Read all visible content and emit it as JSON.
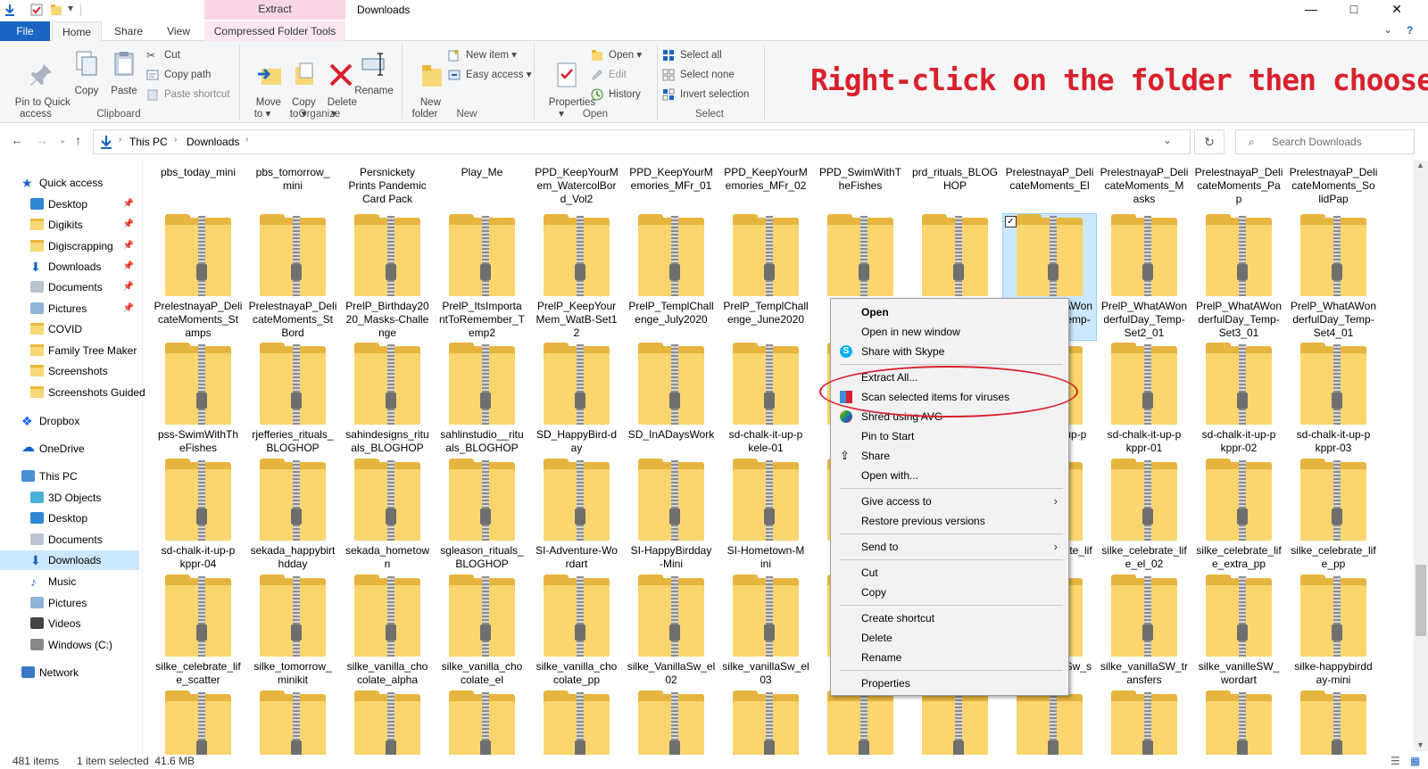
{
  "window": {
    "title": "Downloads",
    "contextual_tab_header": "Extract",
    "controls": {
      "minimize": "—",
      "maximize": "□",
      "close": "✕"
    }
  },
  "tabs": [
    {
      "label": "File"
    },
    {
      "label": "Home"
    },
    {
      "label": "Share"
    },
    {
      "label": "View"
    },
    {
      "label": "Compressed Folder Tools"
    }
  ],
  "ribbon": {
    "clipboard": {
      "group_label": "Clipboard",
      "pin_label": "Pin to Quick\naccess",
      "copy_label": "Copy",
      "paste_label": "Paste",
      "cut_label": "Cut",
      "copy_path_label": "Copy path",
      "paste_shortcut_label": "Paste shortcut"
    },
    "organize": {
      "group_label": "Organize",
      "move_to_label": "Move\nto ▾",
      "copy_to_label": "Copy\nto ▾",
      "delete_label": "Delete\n▾",
      "rename_label": "Rename"
    },
    "new": {
      "group_label": "New",
      "new_folder_label": "New\nfolder",
      "new_item_label": "New item ▾",
      "easy_access_label": "Easy access ▾"
    },
    "open": {
      "group_label": "Open",
      "properties_label": "Properties\n▾",
      "open_label": "Open ▾",
      "edit_label": "Edit",
      "history_label": "History"
    },
    "select": {
      "group_label": "Select",
      "select_all_label": "Select all",
      "select_none_label": "Select none",
      "invert_label": "Invert selection"
    }
  },
  "annotation": "Right-click on the folder then choose:",
  "address": {
    "crumb_root": "This PC",
    "crumb_current": "Downloads",
    "search_placeholder": "Search Downloads"
  },
  "nav_pane": [
    {
      "label": "Quick access",
      "icon": "star-icon",
      "pinned": false,
      "indent": 0
    },
    {
      "label": "Desktop",
      "icon": "desktop-icon",
      "pinned": true,
      "indent": 1
    },
    {
      "label": "Digikits",
      "icon": "folder-icon",
      "pinned": true,
      "indent": 1
    },
    {
      "label": "Digiscrapping",
      "icon": "folder-icon",
      "pinned": true,
      "indent": 1
    },
    {
      "label": "Downloads",
      "icon": "download-icon",
      "pinned": true,
      "indent": 1
    },
    {
      "label": "Documents",
      "icon": "documents-icon",
      "pinned": true,
      "indent": 1
    },
    {
      "label": "Pictures",
      "icon": "pictures-icon",
      "pinned": true,
      "indent": 1
    },
    {
      "label": "COVID",
      "icon": "folder-icon",
      "pinned": false,
      "indent": 1
    },
    {
      "label": "Family Tree Maker",
      "icon": "folder-icon",
      "pinned": false,
      "indent": 1
    },
    {
      "label": "Screenshots",
      "icon": "folder-icon",
      "pinned": false,
      "indent": 1
    },
    {
      "label": "Screenshots Guided",
      "icon": "folder-icon",
      "pinned": false,
      "indent": 1
    },
    {
      "label": "Dropbox",
      "icon": "dropbox-icon",
      "pinned": false,
      "indent": 0
    },
    {
      "label": "OneDrive",
      "icon": "cloud-icon",
      "pinned": false,
      "indent": 0
    },
    {
      "label": "This PC",
      "icon": "computer-icon",
      "pinned": false,
      "indent": 0
    },
    {
      "label": "3D Objects",
      "icon": "cube-icon",
      "pinned": false,
      "indent": 1
    },
    {
      "label": "Desktop",
      "icon": "desktop-icon",
      "pinned": false,
      "indent": 1
    },
    {
      "label": "Documents",
      "icon": "documents-icon",
      "pinned": false,
      "indent": 1
    },
    {
      "label": "Downloads",
      "icon": "download-icon",
      "pinned": false,
      "indent": 1,
      "selected": true
    },
    {
      "label": "Music",
      "icon": "music-icon",
      "pinned": false,
      "indent": 1
    },
    {
      "label": "Pictures",
      "icon": "pictures-icon",
      "pinned": false,
      "indent": 1
    },
    {
      "label": "Videos",
      "icon": "video-icon",
      "pinned": false,
      "indent": 1
    },
    {
      "label": "Windows (C:)",
      "icon": "drive-icon",
      "pinned": false,
      "indent": 1
    },
    {
      "label": "Network",
      "icon": "network-icon",
      "pinned": false,
      "indent": 0
    }
  ],
  "files_partial_row": [
    "pbs_today_mini",
    "pbs_tomorrow_\nmini",
    "Persnickety\nPrints Pandemic\nCard Pack",
    "Play_Me",
    "PPD_KeepYourM\nem_WatercolBor\nd_Vol2",
    "PPD_KeepYourM\nemories_MFr_01",
    "PPD_KeepYourM\nemories_MFr_02",
    "PPD_SwimWithT\nheFishes",
    "prd_rituals_BLOG\nHOP",
    "PrelestnayaP_Deli\ncateMoments_El",
    "PrelestnayaP_Deli\ncateMoments_M\nasks",
    "PrelestnayaP_Deli\ncateMoments_Pa\np",
    "PrelestnayaP_Deli\ncateMoments_So\nlidPap"
  ],
  "files": [
    [
      "PrelestnayaP_Deli\ncateMoments_St\namps",
      "PrelestnayaP_Deli\ncateMoments_St\nBord",
      "PrelP_Birthday20\n20_Masks-Challe\nnge",
      "PrelP_ItsImporta\nntToRemember_T\nemp2",
      "PrelP_KeepYour\nMem_WatB-Set1\n2",
      "PrelP_TemplChall\nenge_July2020",
      "PrelP_TemplChall\nenge_June2020",
      "",
      "",
      "PrelP_WhatAWon\nderfulDay_Temp-\nSet1_01",
      "PrelP_WhatAWon\nderfulDay_Temp-\nSet2_01",
      "PrelP_WhatAWon\nderfulDay_Temp-\nSet3_01",
      "PrelP_WhatAWon\nderfulDay_Temp-\nSet4_01"
    ],
    [
      "pss-SwimWithTh\neFishes",
      "rjefferies_rituals_\nBLOGHOP",
      "sahindesigns_ritu\nals_BLOGHOP",
      "sahlinstudio__ritu\nals_BLOGHOP",
      "SD_HappyBird-d\nay",
      "SD_InADaysWork",
      "sd-chalk-it-up-p\nkele-01",
      "",
      "",
      "sd-chalk-it-up-p\nkppr-04",
      "sd-chalk-it-up-p\nkppr-01",
      "sd-chalk-it-up-p\nkppr-02",
      "sd-chalk-it-up-p\nkppr-03"
    ],
    [
      "sd-chalk-it-up-p\nkppr-04",
      "sekada_happybirt\nhdday",
      "sekada_hometow\nn",
      "sgleason_rituals_\nBLOGHOP",
      "SI-Adventure-Wo\nrdart",
      "SI-HappyBirdday\n-Mini",
      "SI-Hometown-M\nini",
      "",
      "",
      "silke_celebrate_lif\ne_el_01",
      "silke_celebrate_lif\ne_el_02",
      "silke_celebrate_lif\ne_extra_pp",
      "silke_celebrate_lif\ne_pp"
    ],
    [
      "silke_celebrate_lif\ne_scatter",
      "silke_tomorrow_\nminikit",
      "silke_vanilla_cho\ncolate_alpha",
      "silke_vanilla_cho\ncolate_el",
      "silke_vanilla_cho\ncolate_pp",
      "silke_VanillaSw_el\n02",
      "silke_vanillaSw_el\n03",
      "",
      "",
      "silke_vanillaSw_s\nds",
      "silke_vanillaSW_tr\nansfers",
      "silke_vanilleSW_\nwordart",
      "silke-happybirdd\nay-mini"
    ]
  ],
  "visible_file_fragments": {
    "selected": "atWon\n/_Temp-\n01",
    "row2": "-it-up-p\n-04",
    "row3": "ebrate_lif\n01",
    "row4": "llaSw_s\nds"
  },
  "context_menu": [
    {
      "label": "Open",
      "bold": true,
      "icon": ""
    },
    {
      "label": "Open in new window",
      "icon": ""
    },
    {
      "label": "Share with Skype",
      "icon": "skype-icon"
    },
    {
      "sep": true
    },
    {
      "label": "Extract All...",
      "icon": ""
    },
    {
      "label": "Scan selected items for viruses",
      "icon": "defender-icon"
    },
    {
      "label": "Shred using AVG",
      "icon": "avg-icon"
    },
    {
      "label": "Pin to Start",
      "icon": ""
    },
    {
      "label": "Share",
      "icon": "share-icon"
    },
    {
      "label": "Open with...",
      "icon": ""
    },
    {
      "sep": true
    },
    {
      "label": "Give access to",
      "icon": "",
      "submenu": true
    },
    {
      "label": "Restore previous versions",
      "icon": ""
    },
    {
      "sep": true
    },
    {
      "label": "Send to",
      "icon": "",
      "submenu": true
    },
    {
      "sep": true
    },
    {
      "label": "Cut",
      "icon": ""
    },
    {
      "label": "Copy",
      "icon": ""
    },
    {
      "sep": true
    },
    {
      "label": "Create shortcut",
      "icon": ""
    },
    {
      "label": "Delete",
      "icon": ""
    },
    {
      "label": "Rename",
      "icon": ""
    },
    {
      "sep": true
    },
    {
      "label": "Properties",
      "icon": ""
    }
  ],
  "status": {
    "item_count": "481 items",
    "selection": "1 item selected  41.6 MB"
  },
  "colors": {
    "accent": "#1a65c2",
    "annotation": "#d8212c",
    "selection": "#cce8ff",
    "contextual_tab": "#f9d5e8"
  }
}
